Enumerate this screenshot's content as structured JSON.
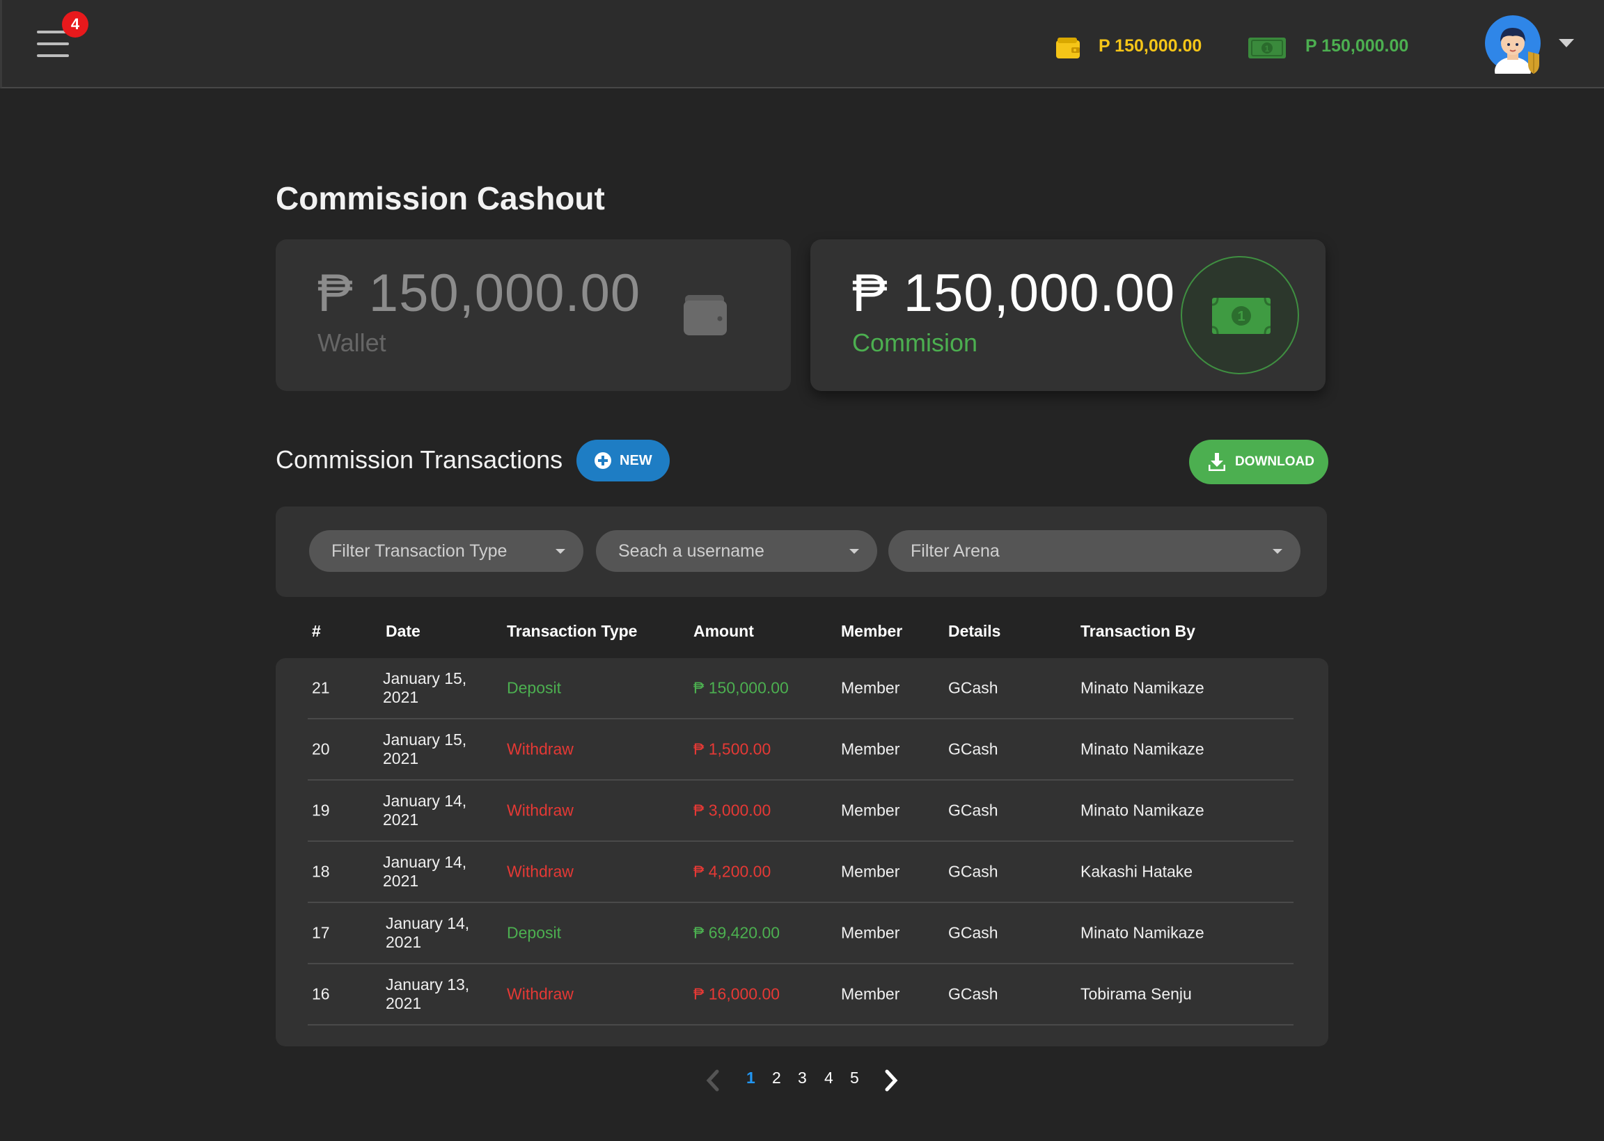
{
  "header": {
    "notification_count": "4",
    "wallet_balance": "P 150,000.00",
    "commission_balance": "P 150,000.00"
  },
  "page": {
    "title": "Commission Cashout"
  },
  "cards": {
    "wallet": {
      "amount": "₱ 150,000.00",
      "label": "Wallet"
    },
    "commission": {
      "amount": "₱ 150,000.00",
      "label": "Commision"
    }
  },
  "transactions": {
    "title": "Commission Transactions",
    "new_label": "NEW",
    "download_label": "DOWNLOAD"
  },
  "filters": {
    "transaction_type": "Filter Transaction Type",
    "username": "Seach a username",
    "arena": "Filter Arena"
  },
  "table": {
    "columns": [
      "#",
      "Date",
      "Transaction Type",
      "Amount",
      "Member",
      "Details",
      "Transaction By"
    ],
    "rows": [
      {
        "id": "21",
        "date": "January 15, 2021",
        "type": "Deposit",
        "amount": "₱ 150,000.00",
        "member": "Member",
        "details": "GCash",
        "by": "Minato Namikaze"
      },
      {
        "id": "20",
        "date": "January 15, 2021",
        "type": "Withdraw",
        "amount": "₱ 1,500.00",
        "member": "Member",
        "details": "GCash",
        "by": "Minato Namikaze"
      },
      {
        "id": "19",
        "date": "January 14, 2021",
        "type": "Withdraw",
        "amount": "₱ 3,000.00",
        "member": "Member",
        "details": "GCash",
        "by": "Minato Namikaze"
      },
      {
        "id": "18",
        "date": "January 14, 2021",
        "type": "Withdraw",
        "amount": "₱ 4,200.00",
        "member": "Member",
        "details": "GCash",
        "by": "Kakashi Hatake"
      },
      {
        "id": "17",
        "date": "January 14, 2021",
        "type": "Deposit",
        "amount": "₱ 69,420.00",
        "member": "Member",
        "details": "GCash",
        "by": "Minato Namikaze"
      },
      {
        "id": "16",
        "date": "January 13, 2021",
        "type": "Withdraw",
        "amount": "₱ 16,000.00",
        "member": "Member",
        "details": "GCash",
        "by": "Tobirama Senju"
      }
    ]
  },
  "pagination": {
    "pages": [
      "1",
      "2",
      "3",
      "4",
      "5"
    ],
    "current": "1"
  },
  "colors": {
    "background": "#242424",
    "panel": "#323232",
    "deposit": "#4caf50",
    "withdraw": "#e53935",
    "primary": "#1e7dc4",
    "wallet_accent": "#f5c518"
  },
  "icons": {
    "menu": "hamburger-icon",
    "wallet": "wallet-icon",
    "commission": "cash-icon",
    "new": "plus-circle-icon",
    "download": "download-icon",
    "avatar": "user-avatar-icon"
  }
}
